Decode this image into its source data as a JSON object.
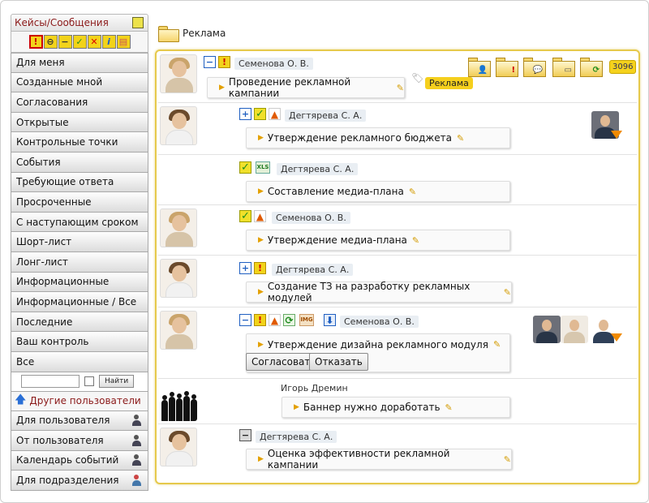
{
  "sidebar": {
    "header": "Кейсы/Сообщения",
    "filter_icons": [
      "exclamation-icon",
      "no-entry-icon",
      "minus-icon",
      "check-icon",
      "cross-icon",
      "info-icon",
      "folder-icon"
    ],
    "items": [
      {
        "label": "Для меня"
      },
      {
        "label": "Созданные мной"
      },
      {
        "label": "Согласования"
      },
      {
        "label": "Открытые"
      },
      {
        "label": "Контрольные точки"
      },
      {
        "label": "События"
      },
      {
        "label": "Требующие ответа"
      },
      {
        "label": "Просроченные"
      },
      {
        "label": "С наступающим сроком"
      },
      {
        "label": "Шорт-лист"
      },
      {
        "label": "Лонг-лист"
      },
      {
        "label": "Информационные"
      },
      {
        "label": "Информационные / Все"
      },
      {
        "label": "Последние"
      },
      {
        "label": "Ваш контроль"
      },
      {
        "label": "Все"
      }
    ],
    "search_button": "Найти",
    "search_value": "",
    "other_users": "Другие пользователи",
    "user_items": [
      {
        "label": "Для пользователя",
        "icon": "user-icon"
      },
      {
        "label": "От пользователя",
        "icon": "user-icon"
      },
      {
        "label": "Календарь событий",
        "icon": "user-icon"
      },
      {
        "label": "Для подразделения",
        "icon": "group-icon"
      }
    ]
  },
  "breadcrumb": {
    "label": "Реклама"
  },
  "tasks": [
    {
      "user": "Семенова О. В.",
      "title": "Проведение рекламной кампании",
      "tag": "Реклама",
      "count": "3096"
    },
    {
      "user": "Дегтярева С. А.",
      "title": "Утверждение рекламного бюджета"
    },
    {
      "user": "Дегтярева С. А.",
      "title": "Составление медиа-плана",
      "file_type": "XLS"
    },
    {
      "user": "Семенова О. В.",
      "title": "Утверждение медиа-плана"
    },
    {
      "user": "Дегтярева С. А.",
      "title": "Создание ТЗ на разработку рекламных модулей"
    },
    {
      "user": "Семенова О. В.",
      "title": "Утверждение дизайна рекламного модуля",
      "file_type": "IMG",
      "buttons": {
        "approve": "Согласовать",
        "reject": "Отказать"
      }
    },
    {
      "user": "Игорь Дремин",
      "title": "Баннер нужно доработать"
    },
    {
      "user": "Дегтярева С. А.",
      "title": "Оценка эффективности рекламной кампании"
    }
  ],
  "colors": {
    "accent_border": "#e6c94c",
    "tag": "#f5cf1d",
    "header_text": "#8b1a1a"
  }
}
